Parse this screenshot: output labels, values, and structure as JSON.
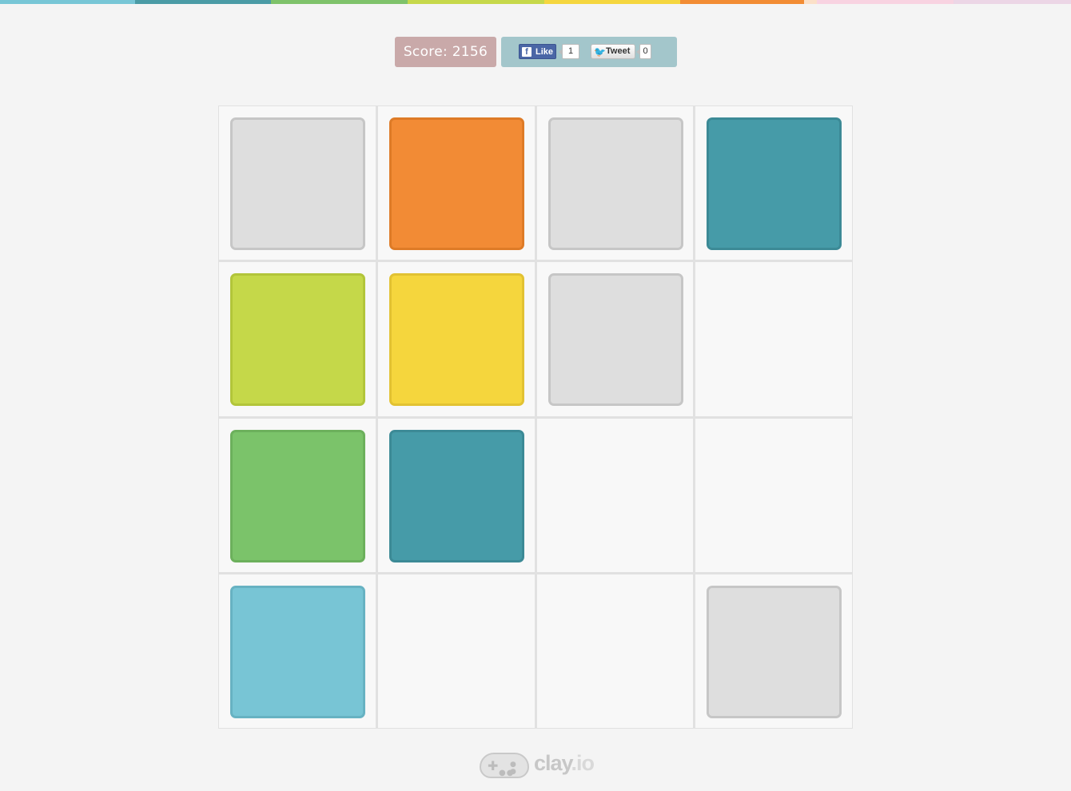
{
  "stripe_colors": [
    "#77c6d6",
    "#4a9ba5",
    "#7ec26a",
    "#c6d84b",
    "#f5d63f",
    "#f28c34",
    "#fbe0c8",
    "#f8d3e1",
    "#ecd6e6"
  ],
  "header": {
    "score_text": "Score: 2156",
    "facebook": {
      "like_label": "Like",
      "count": "1"
    },
    "twitter": {
      "tweet_label": "Tweet",
      "count": "0"
    }
  },
  "board": {
    "rows": 4,
    "cols": 4,
    "tiles": [
      [
        "gray",
        "orange",
        "gray",
        "teal"
      ],
      [
        "lime",
        "yellow",
        "gray",
        "empty"
      ],
      [
        "green",
        "teal",
        "empty",
        "empty"
      ],
      [
        "lightblue",
        "empty",
        "empty",
        "gray"
      ]
    ],
    "colors": {
      "gray": {
        "fill": "#dedede",
        "border": "#c6c6c6"
      },
      "orange": {
        "fill": "#f28b35",
        "border": "#de7b27"
      },
      "teal": {
        "fill": "#469ba8",
        "border": "#3c8a96"
      },
      "lime": {
        "fill": "#c5d849",
        "border": "#b2c53a"
      },
      "yellow": {
        "fill": "#f5d63d",
        "border": "#e2c232"
      },
      "green": {
        "fill": "#7bc36a",
        "border": "#6cb05c"
      },
      "lightblue": {
        "fill": "#78c5d5",
        "border": "#67b2c2"
      }
    }
  },
  "footer": {
    "logo_main": "clay",
    "logo_suffix": ".io"
  }
}
